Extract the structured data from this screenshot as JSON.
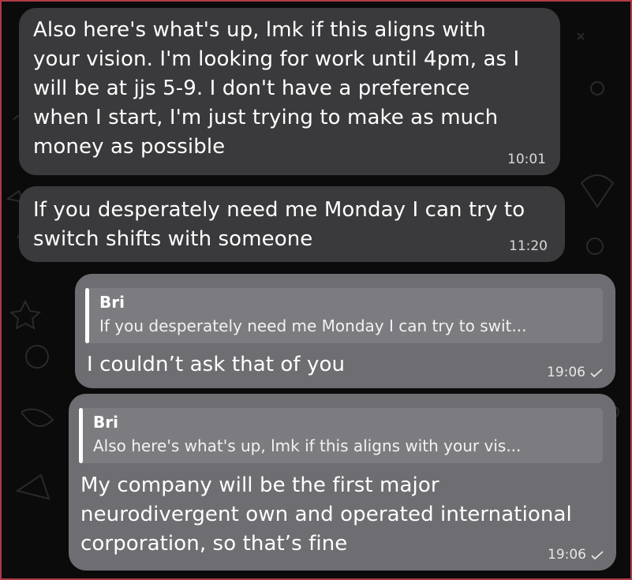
{
  "messages": [
    {
      "direction": "incoming",
      "lines": [
        "Also here's what's up, lmk if this aligns with",
        "your vision. I'm looking for work until 4pm, as I",
        "will be at jjs 5-9. I don't have a preference",
        "when I start, I'm just trying to make as much",
        "money as possible"
      ],
      "time": "10:01"
    },
    {
      "direction": "incoming",
      "lines": [
        "If you desperately need me Monday I can try to",
        "switch shifts with someone"
      ],
      "time": "11:20"
    },
    {
      "direction": "outgoing",
      "reply_to": {
        "sender": "Bri",
        "preview": "If you desperately need me Monday I can try to swit..."
      },
      "lines": [
        "I couldn’t ask that of you"
      ],
      "time": "19:06",
      "status": "sent-check-icon"
    },
    {
      "direction": "outgoing",
      "reply_to": {
        "sender": "Bri",
        "preview": "Also here's what's up, lmk if this aligns with your vis..."
      },
      "lines": [
        "My company will be the first major",
        "neurodivergent own and operated international",
        "corporation, so that’s fine"
      ],
      "time": "19:06",
      "status": "sent-check-icon"
    }
  ],
  "colors": {
    "background": "#0b0b0b",
    "incoming_bubble": "#3a3a3c",
    "outgoing_bubble": "#6e6e72",
    "reply_box": "#7c7c80",
    "frame": "#b23a48"
  }
}
